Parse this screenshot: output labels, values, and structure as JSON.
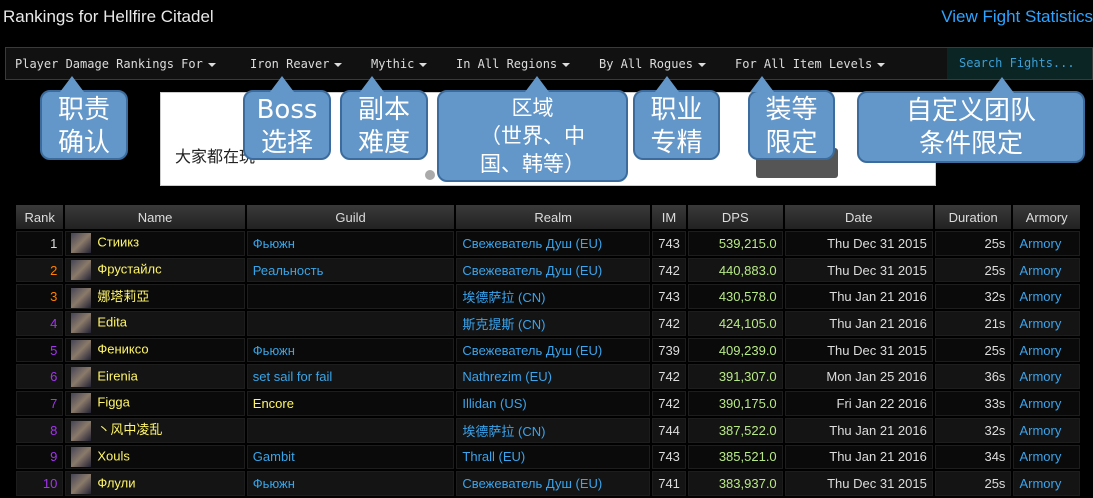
{
  "header": {
    "title": "Rankings for Hellfire Citadel",
    "stats_link": "View Fight Statistics"
  },
  "filters": {
    "items": [
      "Player Damage Rankings For",
      "Iron Reaver",
      "Mythic",
      "In All Regions",
      "By All Rogues",
      "For All Item Levels"
    ],
    "search": "Search Fights..."
  },
  "banner": {
    "text": "大家都在玩"
  },
  "callouts": [
    "职责\n确认",
    "Boss\n选择",
    "副本\n难度",
    "区域\n（世界、中\n国、韩等）",
    "职业\n专精",
    "装等\n限定",
    "自定义团队\n条件限定"
  ],
  "table": {
    "headers": [
      "Rank",
      "Name",
      "Guild",
      "Realm",
      "IM",
      "DPS",
      "Date",
      "Duration",
      "Armory"
    ],
    "rank_colors": [
      "#dddddd",
      "#ff8000",
      "#ff8000",
      "#a335ee",
      "#a335ee",
      "#a335ee",
      "#a335ee",
      "#a335ee",
      "#a335ee",
      "#a335ee"
    ],
    "rows": [
      [
        "1",
        "Стиикз",
        "Фьюжн",
        "Свежеватель Душ (EU)",
        "743",
        "539,215.0",
        "Thu Dec 31 2015",
        "25s",
        "Armory"
      ],
      [
        "2",
        "Фрустайлс",
        "Реальность",
        "Свежеватель Душ (EU)",
        "742",
        "440,883.0",
        "Thu Dec 31 2015",
        "25s",
        "Armory"
      ],
      [
        "3",
        "娜塔莉亞",
        "",
        "埃德萨拉 (CN)",
        "743",
        "430,578.0",
        "Thu Jan 21 2016",
        "32s",
        "Armory"
      ],
      [
        "4",
        "Edita",
        "",
        "斯克提斯 (CN)",
        "742",
        "424,105.0",
        "Thu Jan 21 2016",
        "21s",
        "Armory"
      ],
      [
        "5",
        "Фениксо",
        "Фьюжн",
        "Свежеватель Душ (EU)",
        "739",
        "409,239.0",
        "Thu Dec 31 2015",
        "25s",
        "Armory"
      ],
      [
        "6",
        "Eirenia",
        "set sail for fail",
        "Nathrezim (EU)",
        "742",
        "391,307.0",
        "Mon Jan 25 2016",
        "36s",
        "Armory"
      ],
      [
        "7",
        "Figga",
        "Encore",
        "Illidan (US)",
        "742",
        "390,175.0",
        "Fri Jan 22 2016",
        "33s",
        "Armory"
      ],
      [
        "8",
        "丶风中凌乱",
        "",
        "埃德萨拉 (CN)",
        "744",
        "387,522.0",
        "Thu Jan 21 2016",
        "32s",
        "Armory"
      ],
      [
        "9",
        "Xouls",
        "Gambit",
        "Thrall (EU)",
        "743",
        "385,521.0",
        "Thu Jan 21 2016",
        "34s",
        "Armory"
      ],
      [
        "10",
        "Флули",
        "Фьюжн",
        "Свежеватель Душ (EU)",
        "741",
        "383,937.0",
        "Thu Dec 31 2015",
        "25s",
        "Armory"
      ]
    ]
  }
}
